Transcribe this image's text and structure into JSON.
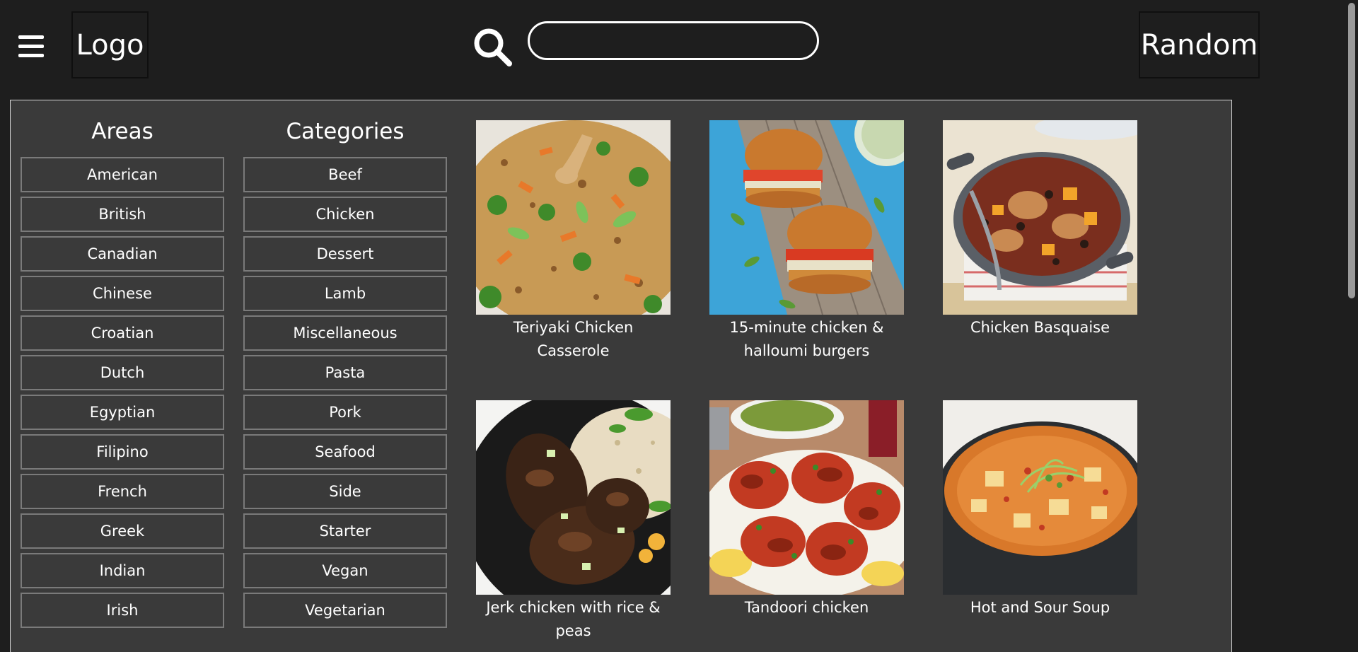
{
  "header": {
    "logo_label": "Logo",
    "random_label": "Random",
    "search": {
      "value": "",
      "placeholder": ""
    },
    "icons": {
      "menu": "hamburger-menu-icon",
      "search": "magnifier-icon"
    }
  },
  "areas": {
    "title": "Areas",
    "items": [
      "American",
      "British",
      "Canadian",
      "Chinese",
      "Croatian",
      "Dutch",
      "Egyptian",
      "Filipino",
      "French",
      "Greek",
      "Indian",
      "Irish"
    ]
  },
  "categories": {
    "title": "Categories",
    "items": [
      "Beef",
      "Chicken",
      "Dessert",
      "Lamb",
      "Miscellaneous",
      "Pasta",
      "Pork",
      "Seafood",
      "Side",
      "Starter",
      "Vegan",
      "Vegetarian"
    ]
  },
  "meals": [
    {
      "name": "Teriyaki Chicken Casserole"
    },
    {
      "name": "15-minute chicken & halloumi burgers"
    },
    {
      "name": "Chicken Basquaise"
    },
    {
      "name": "Jerk chicken with rice & peas"
    },
    {
      "name": "Tandoori chicken"
    },
    {
      "name": "Hot and Sour Soup"
    }
  ],
  "colors": {
    "page_background": "#1e1e1e",
    "panel_background": "#3a3a3a",
    "panel_border": "#d8d8d8",
    "button_border": "#7a7a7a",
    "text": "#ffffff"
  }
}
